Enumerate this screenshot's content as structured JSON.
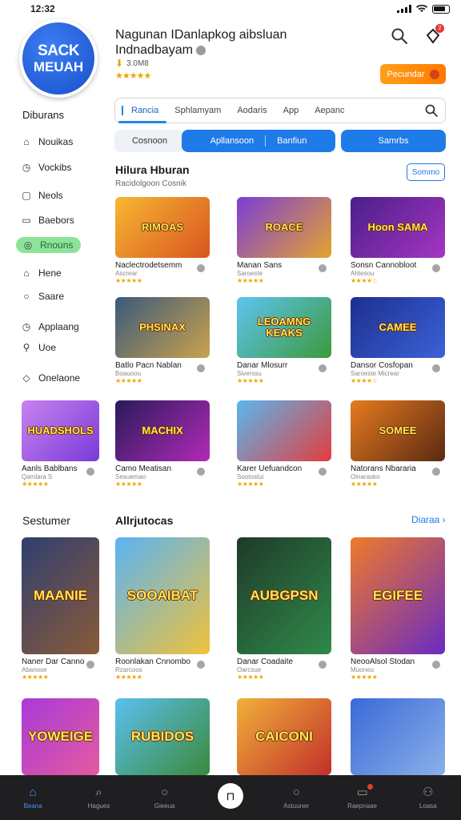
{
  "status": {
    "time": "12:32"
  },
  "header": {
    "logo_line1": "SACK",
    "logo_line2": "MEUAH",
    "title": "Nagunan IDanlapkog aibsluan Indnadbayam",
    "meta": "3.0M8",
    "stars": "★★★★★",
    "promo_label": "Pecundar",
    "notif_count": "2"
  },
  "sidebar": {
    "heading": "Diburans",
    "items": [
      {
        "label": "Nouikas",
        "icon": "home-icon"
      },
      {
        "label": "Vockibs",
        "icon": "clock-icon"
      },
      {
        "label": "Neols",
        "icon": "square-icon"
      },
      {
        "label": "Baebors",
        "icon": "book-icon"
      },
      {
        "label": "Rnouns",
        "icon": "circle-icon",
        "active": true
      },
      {
        "label": "Hene",
        "icon": "house-icon"
      },
      {
        "label": "Saare",
        "icon": "share-icon"
      },
      {
        "label": "Applaang",
        "icon": "app-icon"
      },
      {
        "label": "Uoe",
        "icon": "pin-icon"
      },
      {
        "label": "Onelaone",
        "icon": "diamond-icon"
      }
    ]
  },
  "search": {
    "tabs": [
      "Rancia",
      "Sphlamyam",
      "Aodaris",
      "App",
      "Aepanc"
    ]
  },
  "filters": {
    "chip1": "Cosnoon",
    "chip2": "Apllansoon",
    "chip2b": "Banfiun",
    "chip3": "Samrbs"
  },
  "section1": {
    "title": "Hilura Hburan",
    "subtitle": "Racidolgoon Cosnik",
    "button": "Sommo"
  },
  "section2": {
    "title_left": "Sestumer",
    "title": "Allrjutocas",
    "see_all": "Diaraa ›"
  },
  "grid1": [
    {
      "name": "Naclectrodetsemm",
      "sub": "Ascrear",
      "stars": "★★★★★",
      "thumb": "RIMOAS",
      "c1": "#f7b733",
      "c2": "#d8541f"
    },
    {
      "name": "Manan Sans",
      "sub": "Saroeste",
      "stars": "★★★★★",
      "thumb": "ROACE",
      "c1": "#7b3fd6",
      "c2": "#e5a22d"
    },
    {
      "name": "Sonsn Cannobloot",
      "sub": "Ahtesou",
      "stars": "★★★★☆",
      "thumb": "Hoon SAMA",
      "c1": "#4a1f8a",
      "c2": "#a535c2"
    },
    {
      "name": "Batlo Pacn Nablan",
      "sub": "Boauoou",
      "stars": "★★★★★",
      "thumb": "PHSINAX",
      "c1": "#3a5a7a",
      "c2": "#caa24d"
    },
    {
      "name": "Danar Mlosurr",
      "sub": "Siverssu",
      "stars": "★★★★★",
      "thumb": "LEOAMNG KEAKS",
      "c1": "#5ec4f2",
      "c2": "#3c9a3a"
    },
    {
      "name": "Dansor Cosfopan",
      "sub": "Saroeste Micrear",
      "stars": "★★★★☆",
      "thumb": "CAMEE",
      "c1": "#1d2f8f",
      "c2": "#3a62d8"
    },
    {
      "name": "Camo Meatisan",
      "sub": "Sesuemao",
      "stars": "★★★★★",
      "thumb": "MACHIX",
      "c1": "#2a1a5a",
      "c2": "#b12ab8"
    },
    {
      "name": "Karer Uefuandcon",
      "sub": "Sootostui",
      "stars": "★★★★★",
      "thumb": "",
      "c1": "#5ab7f0",
      "c2": "#e23d3d"
    },
    {
      "name": "Natorans Nbararia",
      "sub": "Oinarasko",
      "stars": "★★★★★",
      "thumb": "SOMEE",
      "c1": "#e67a1e",
      "c2": "#5a2a12"
    }
  ],
  "side_card": {
    "name": "Aanls Bablbans",
    "sub": "Qamlara S",
    "stars": "★★★★★",
    "thumb": "HUADSHOLS",
    "c1": "#c783f0",
    "c2": "#7a3ad8"
  },
  "grid2": [
    {
      "name": "Naner Dar Canno",
      "sub": "Abanose",
      "stars": "★★★★★",
      "thumb": "MAANIE",
      "c1": "#2f3f6e",
      "c2": "#8a5a3a"
    },
    {
      "name": "Roonlakan Cnnombo",
      "sub": "Rzarcoos",
      "stars": "★★★★★",
      "thumb": "SOOAIBAT",
      "c1": "#5ab3f5",
      "c2": "#f0c23a"
    },
    {
      "name": "Danar Coadaite",
      "sub": "Oarcsue",
      "stars": "★★★★★",
      "thumb": "AUBGPSN",
      "c1": "#1f3a2a",
      "c2": "#2f8a4a"
    },
    {
      "name": "NeooAlsol Stodan",
      "sub": "Muoneu",
      "stars": "★★★★★",
      "thumb": "EGIFEE",
      "c1": "#f07a2a",
      "c2": "#6a2ac2"
    },
    {
      "name": "",
      "sub": "",
      "stars": "",
      "thumb": "YOWEIGE",
      "c1": "#a83ad8",
      "c2": "#e55aa0"
    },
    {
      "name": "",
      "sub": "",
      "stars": "",
      "thumb": "RUBIDOS",
      "c1": "#5ac0f0",
      "c2": "#3a8a3a"
    },
    {
      "name": "",
      "sub": "",
      "stars": "",
      "thumb": "CAICONI",
      "c1": "#f0b03a",
      "c2": "#c2302a"
    },
    {
      "name": "",
      "sub": "",
      "stars": "",
      "thumb": "",
      "c1": "#3a6ad8",
      "c2": "#8ab0e8"
    }
  ],
  "bottom_nav": [
    {
      "label": "Beana",
      "icon": "home-icon",
      "active": true
    },
    {
      "label": "Hagues",
      "icon": "search-icon"
    },
    {
      "label": "Gieeua",
      "icon": "circle-icon"
    },
    {
      "label": "",
      "icon": "center-icon",
      "center": true
    },
    {
      "label": "Astuuner",
      "icon": "circle-icon"
    },
    {
      "label": "Raepnaae",
      "icon": "message-icon",
      "badge": true
    },
    {
      "label": "Loasa",
      "icon": "profile-icon"
    }
  ]
}
